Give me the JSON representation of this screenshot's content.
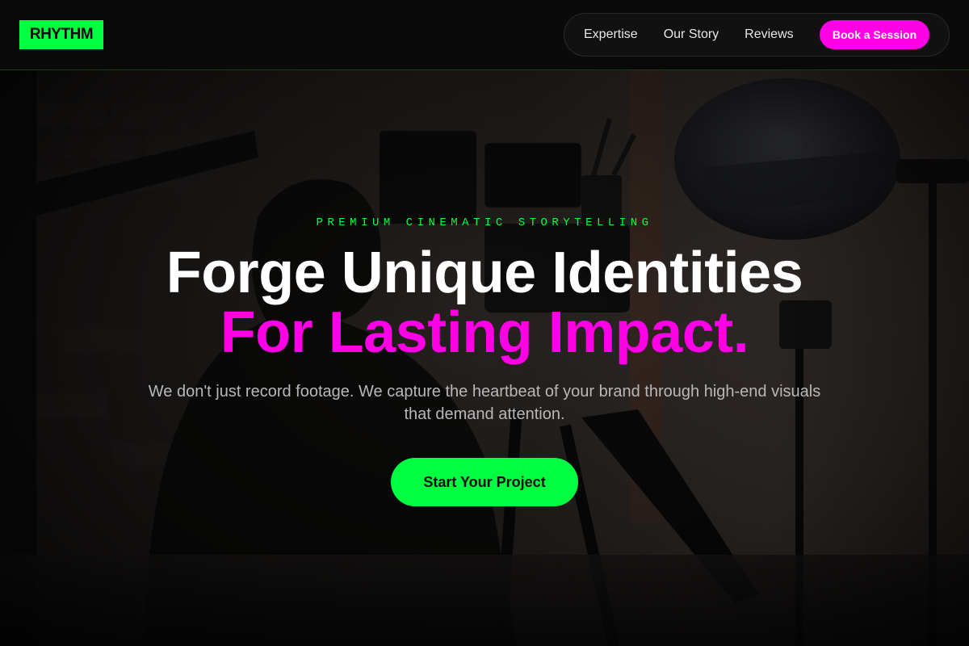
{
  "brand": {
    "logo_text": "RHYTHM",
    "accent_green": "#00ff41",
    "accent_magenta": "#ff00e6"
  },
  "nav": {
    "links": [
      "Expertise",
      "Our Story",
      "Reviews"
    ],
    "cta_label": "Book a Session"
  },
  "hero": {
    "eyebrow": "PREMIUM CINEMATIC STORYTELLING",
    "headline": "Forge Unique Identities",
    "headline_accent": "For Lasting Impact.",
    "subtext": "We don't just record footage. We capture the heartbeat of your brand through high-end visuals that demand attention.",
    "cta_label": "Start Your Project",
    "background_image": "camera-operator-studio-photo"
  }
}
